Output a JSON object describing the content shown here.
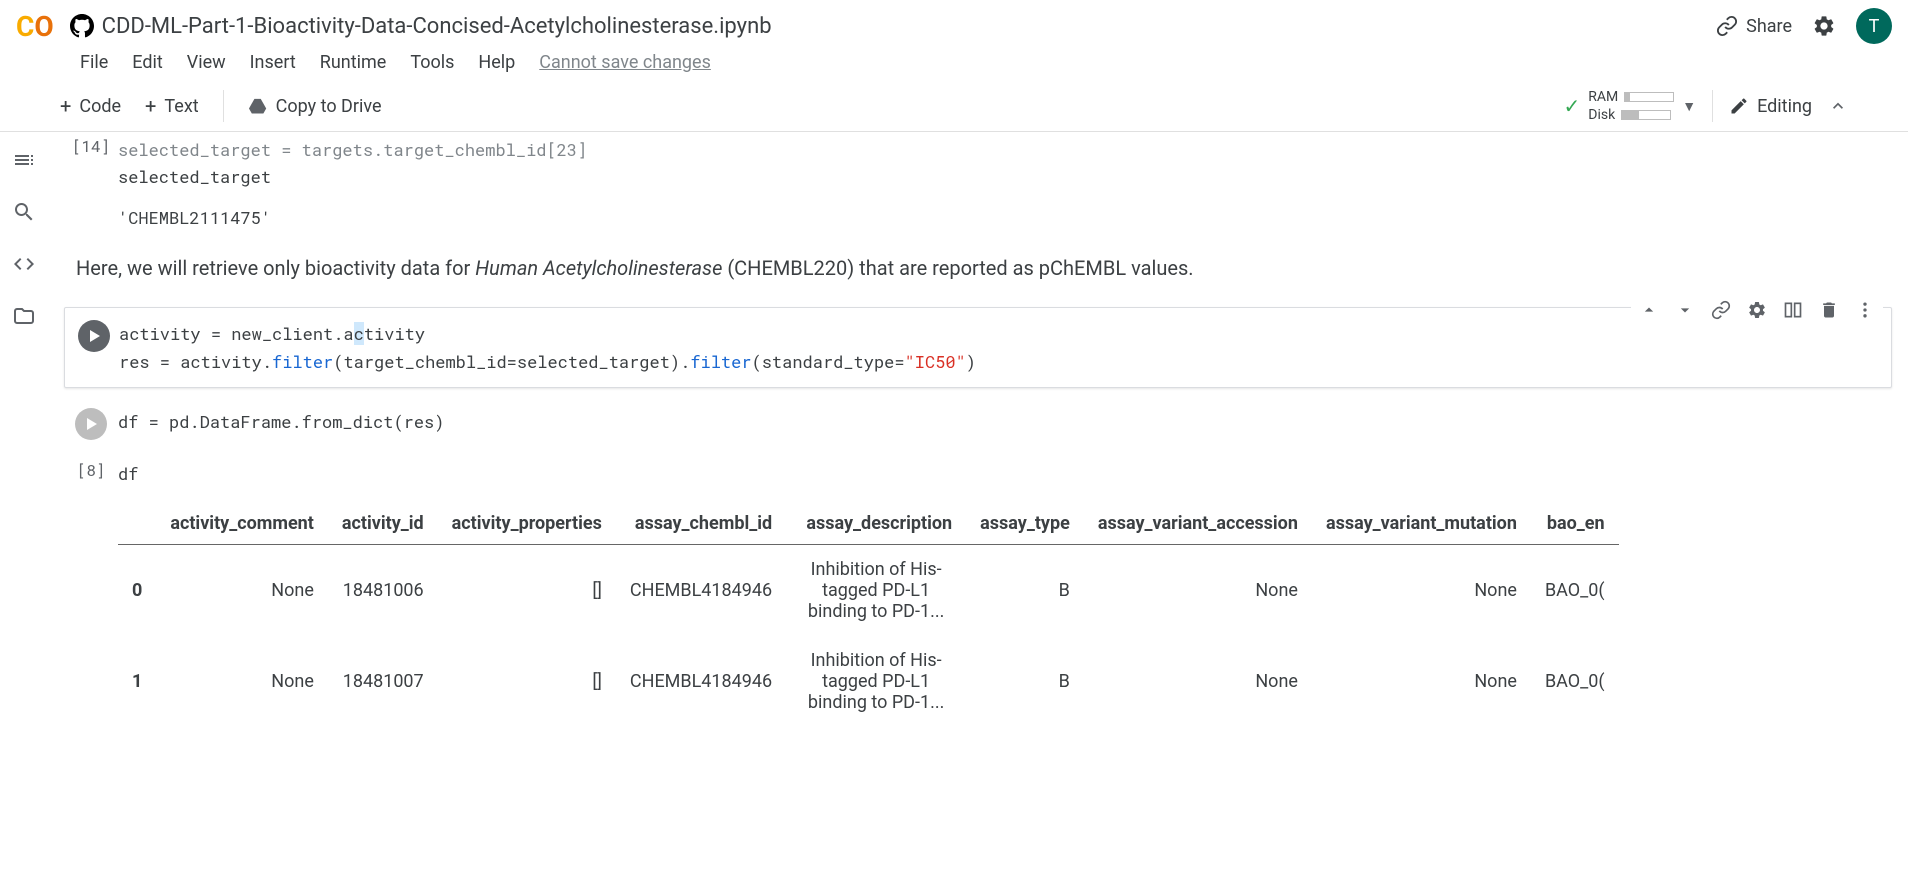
{
  "header": {
    "title": "CDD-ML-Part-1-Bioactivity-Data-Concised-Acetylcholinesterase.ipynb",
    "share_label": "Share",
    "avatar_letter": "T"
  },
  "menubar": {
    "file": "File",
    "edit": "Edit",
    "view": "View",
    "insert": "Insert",
    "runtime": "Runtime",
    "tools": "Tools",
    "help": "Help",
    "cannot_save": "Cannot save changes"
  },
  "toolbar": {
    "code": "Code",
    "text": "Text",
    "copy_drive": "Copy to Drive",
    "ram": "RAM",
    "disk": "Disk",
    "editing": "Editing"
  },
  "cells": {
    "c14_exec": "[14]",
    "c14_line0": "selected_target = targets.target_chembl_id[23]",
    "c14_line1": "selected_target",
    "c14_output": "'CHEMBL2111475'",
    "text1_pre": "Here, we will retrieve only bioactivity data for ",
    "text1_em": "Human Acetylcholinesterase",
    "text1_post": " (CHEMBL220) that are reported as pChEMBL values.",
    "c_act_l1_a": "activity = new_client.a",
    "c_act_l1_b": "c",
    "c_act_l1_c": "tivity",
    "c_act_l2_a": "res = activity.",
    "c_act_l2_b": "filter",
    "c_act_l2_c": "(target_chembl_id=selected_target).",
    "c_act_l2_d": "filter",
    "c_act_l2_e": "(standard_type=",
    "c_act_l2_f": "\"IC50\"",
    "c_act_l2_g": ")",
    "c_df_line": "df = pd.DataFrame.from_dict(res)",
    "c8_exec": "[8]",
    "c8_line": "df"
  },
  "table": {
    "headers": [
      "",
      "activity_comment",
      "activity_id",
      "activity_properties",
      "assay_chembl_id",
      "assay_description",
      "assay_type",
      "assay_variant_accession",
      "assay_variant_mutation",
      "bao_en"
    ],
    "rows": [
      {
        "idx": "0",
        "activity_comment": "None",
        "activity_id": "18481006",
        "activity_properties": "[]",
        "assay_chembl_id": "CHEMBL4184946",
        "assay_description": "Inhibition of His-tagged PD-L1 binding to PD-1...",
        "assay_type": "B",
        "assay_variant_accession": "None",
        "assay_variant_mutation": "None",
        "bao_en": "BAO_0("
      },
      {
        "idx": "1",
        "activity_comment": "None",
        "activity_id": "18481007",
        "activity_properties": "[]",
        "assay_chembl_id": "CHEMBL4184946",
        "assay_description": "Inhibition of His-tagged PD-L1 binding to PD-1...",
        "assay_type": "B",
        "assay_variant_accession": "None",
        "assay_variant_mutation": "None",
        "bao_en": "BAO_0("
      }
    ]
  }
}
